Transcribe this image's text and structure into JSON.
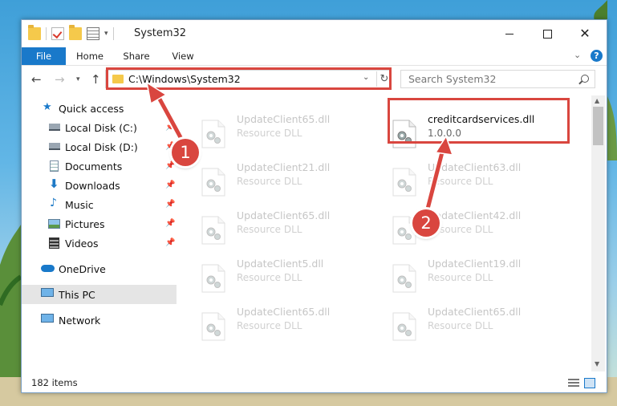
{
  "window": {
    "title": "System32"
  },
  "ribbon": {
    "tabs": [
      "File",
      "Home",
      "Share",
      "View"
    ]
  },
  "nav": {
    "address": "C:\\Windows\\System32",
    "search_placeholder": "Search System32"
  },
  "sidebar": {
    "items": [
      {
        "label": "Quick access",
        "icon": "star-icon"
      },
      {
        "label": "Local Disk (C:)",
        "icon": "drive-icon",
        "pinned": true
      },
      {
        "label": "Local Disk (D:)",
        "icon": "drive-icon",
        "pinned": true
      },
      {
        "label": "Documents",
        "icon": "documents-icon",
        "pinned": true
      },
      {
        "label": "Downloads",
        "icon": "download-icon",
        "pinned": true
      },
      {
        "label": "Music",
        "icon": "music-icon",
        "pinned": true
      },
      {
        "label": "Pictures",
        "icon": "pictures-icon",
        "pinned": true
      },
      {
        "label": "Videos",
        "icon": "videos-icon",
        "pinned": true
      },
      {
        "label": "OneDrive",
        "icon": "cloud-icon"
      },
      {
        "label": "This PC",
        "icon": "computer-icon",
        "selected": true
      },
      {
        "label": "Network",
        "icon": "network-icon"
      }
    ]
  },
  "files": {
    "left": [
      {
        "name": "UpdateClient65.dll",
        "type": "Resource DLL"
      },
      {
        "name": "UpdateClient21.dll",
        "type": "Resource DLL"
      },
      {
        "name": "UpdateClient65.dll",
        "type": "Resource DLL"
      },
      {
        "name": "UpdateClient5.dll",
        "type": "Resource DLL"
      },
      {
        "name": "UpdateClient65.dll",
        "type": "Resource DLL"
      }
    ],
    "right": [
      {
        "name": "creditcardservices.dll",
        "type": "1.0.0.0",
        "featured": true
      },
      {
        "name": "UpdateClient63.dll",
        "type": "Resource DLL"
      },
      {
        "name": "UpdateClient42.dll",
        "type": "Resource DLL"
      },
      {
        "name": "UpdateClient19.dll",
        "type": "Resource DLL"
      },
      {
        "name": "UpdateClient65.dll",
        "type": "Resource DLL"
      }
    ]
  },
  "status": {
    "item_count": "182 items"
  },
  "annotations": {
    "step1": "1",
    "step2": "2"
  },
  "colors": {
    "accent": "#1979ca",
    "highlight": "#d9463f"
  }
}
